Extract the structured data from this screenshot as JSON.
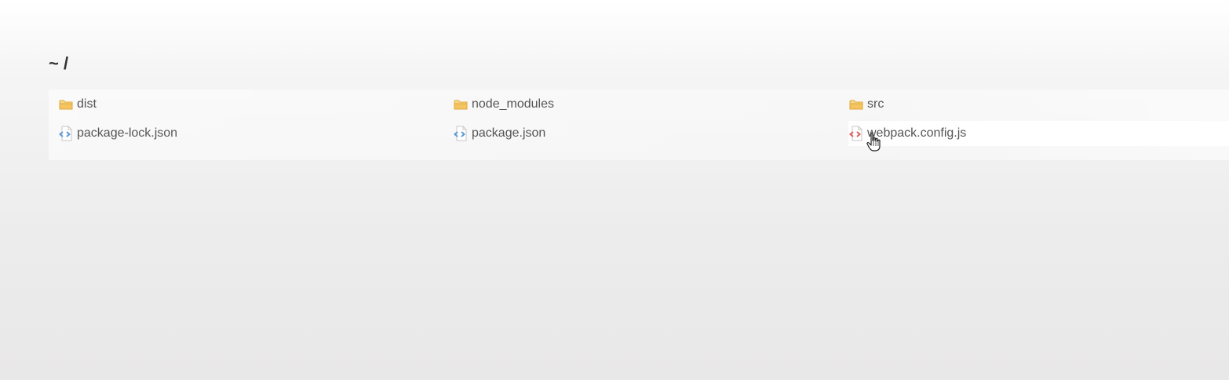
{
  "breadcrumb": {
    "path": "~ /"
  },
  "files": [
    {
      "name": "dist",
      "icon": "folder-icon",
      "kind": "folder"
    },
    {
      "name": "node_modules",
      "icon": "folder-icon",
      "kind": "folder"
    },
    {
      "name": "src",
      "icon": "folder-icon",
      "kind": "folder"
    },
    {
      "name": "package-lock.json",
      "icon": "json-file-icon",
      "kind": "file"
    },
    {
      "name": "package.json",
      "icon": "json-file-icon",
      "kind": "file"
    },
    {
      "name": "webpack.config.js",
      "icon": "js-file-icon",
      "kind": "file"
    }
  ],
  "colors": {
    "folder": "#f3c15f",
    "json_icon": "#5b9bd5",
    "js_icon": "#e05d5d",
    "text": "#555555",
    "title": "#333333"
  }
}
